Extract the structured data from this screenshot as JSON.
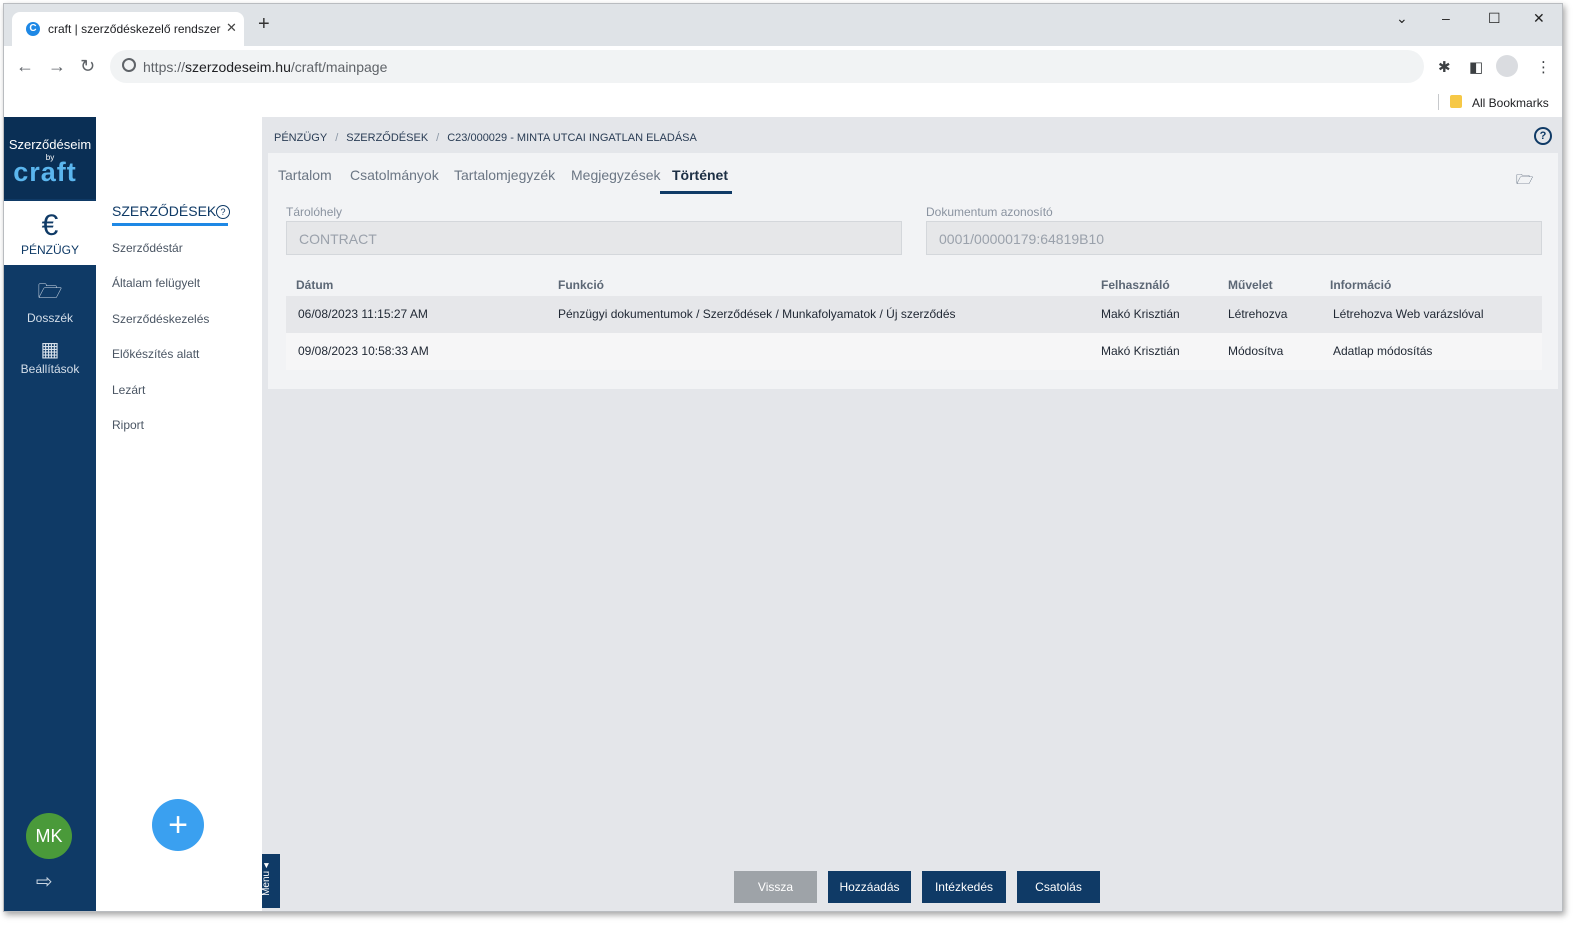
{
  "browser": {
    "tab_title": "craft | szerződéskezelő rendszer",
    "favicon_letter": "C",
    "url_scheme": "https://",
    "url_host": "szerzodeseim.hu",
    "url_path": "/craft/mainpage",
    "bookmarks_label": "All Bookmarks"
  },
  "logo": {
    "top": "Szerződéseim",
    "by": "by",
    "brand": "craft"
  },
  "rail": {
    "items": [
      {
        "label": "PÉNZÜGY",
        "icon": "€"
      },
      {
        "label": "Dosszék",
        "icon": "🗁"
      },
      {
        "label": "Beállítások",
        "icon": "▦"
      }
    ],
    "avatar_initials": "MK"
  },
  "subnav": {
    "title": "SZERZŐDÉSEK",
    "items": [
      "Szerződéstár",
      "Általam felügyelt",
      "Szerződéskezelés",
      "Előkészítés alatt",
      "Lezárt",
      "Riport"
    ],
    "fab": "+",
    "menu_tab": "Menu ◂"
  },
  "breadcrumb": [
    "PÉNZÜGY",
    "SZERZŐDÉSEK",
    "C23/000029 - MINTA UTCAI INGATLAN ELADÁSA"
  ],
  "tabs": [
    "Tartalom",
    "Csatolmányok",
    "Tartalomjegyzék",
    "Megjegyzések",
    "Történet"
  ],
  "fields": {
    "storage_label": "Tárolóhely",
    "storage_value": "CONTRACT",
    "docid_label": "Dokumentum azonosító",
    "docid_value": "0001/00000179:64819B10"
  },
  "table": {
    "headers": [
      "Dátum",
      "Funkció",
      "Felhasználó",
      "Művelet",
      "Információ"
    ],
    "rows": [
      [
        "06/08/2023 11:15:27 AM",
        "Pénzügyi dokumentumok / Szerződések / Munkafolyamatok / Új szerződés",
        "Makó Krisztián",
        "Létrehozva",
        "Létrehozva Web varázslóval"
      ],
      [
        "09/08/2023 10:58:33 AM",
        "",
        "Makó Krisztián",
        "Módosítva",
        "Adatlap módosítás"
      ]
    ]
  },
  "actions": [
    "Vissza",
    "Hozzáadás",
    "Intézkedés",
    "Csatolás"
  ]
}
